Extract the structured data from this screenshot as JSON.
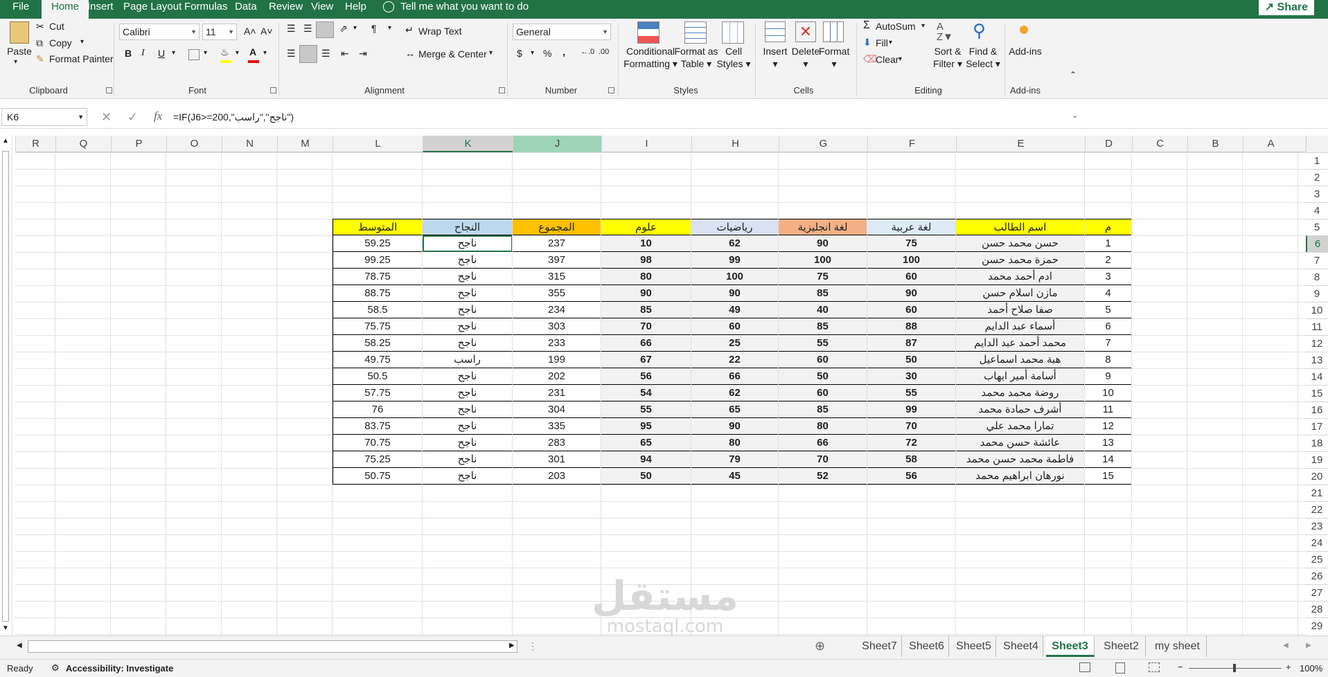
{
  "menu": {
    "items": [
      "File",
      "Home",
      "Insert",
      "Page Layout",
      "Formulas",
      "Data",
      "Review",
      "View",
      "Help"
    ],
    "tell_me": "Tell me what you want to do",
    "share": "Share"
  },
  "ribbon": {
    "clipboard": {
      "paste": "Paste",
      "cut": "Cut",
      "copy": "Copy",
      "format_painter": "Format Painter",
      "label": "Clipboard"
    },
    "font": {
      "name": "Calibri",
      "size": "11",
      "label": "Font"
    },
    "alignment": {
      "wrap": "Wrap Text",
      "merge": "Merge & Center",
      "label": "Alignment"
    },
    "number": {
      "format": "General",
      "label": "Number"
    },
    "styles": {
      "cond1": "Conditional",
      "cond2": "Formatting",
      "fmt1": "Format as",
      "fmt2": "Table",
      "cell1": "Cell",
      "cell2": "Styles",
      "label": "Styles"
    },
    "cells": {
      "insert": "Insert",
      "delete": "Delete",
      "format": "Format",
      "label": "Cells"
    },
    "editing": {
      "autosum": "AutoSum",
      "fill": "Fill",
      "clear": "Clear",
      "sort1": "Sort &",
      "sort2": "Filter",
      "find1": "Find &",
      "find2": "Select",
      "label": "Editing"
    },
    "addins": {
      "btn": "Add-ins",
      "label": "Add-ins"
    }
  },
  "formula_bar": {
    "name_box": "K6",
    "formula": "=IF(J6>=200,\"ناجح\",\"راسب\")"
  },
  "columns": [
    "R",
    "Q",
    "P",
    "O",
    "N",
    "M",
    "L",
    "K",
    "J",
    "I",
    "H",
    "G",
    "F",
    "E",
    "D",
    "C",
    "B",
    "A"
  ],
  "rows": [
    "1",
    "2",
    "3",
    "4",
    "5",
    "6",
    "7",
    "8",
    "9",
    "10",
    "11",
    "12",
    "13",
    "14",
    "15",
    "16",
    "17",
    "18",
    "19",
    "20",
    "21",
    "22",
    "23",
    "24",
    "25",
    "26",
    "27",
    "28",
    "29"
  ],
  "table": {
    "headers": {
      "L": "المتوسط",
      "K": "النجاح",
      "J": "المجموع",
      "I": "علوم",
      "H": "رياضيات",
      "G": "لغة انجليزية",
      "F": "لغة عربية",
      "E": "اسم الطالب",
      "D": "م"
    },
    "header_colors": {
      "L": "#ffff00",
      "K": "#bdd7ee",
      "J": "#ffc000",
      "I": "#ffff00",
      "H": "#d9e1f2",
      "G": "#f4b084",
      "F": "#ddebf7",
      "E": "#ffff00",
      "D": "#ffff00"
    },
    "rows": [
      {
        "L": "59.25",
        "K": "ناجح",
        "J": "237",
        "I": "10",
        "H": "62",
        "G": "90",
        "F": "75",
        "E": "حسن محمد حسن",
        "D": "1"
      },
      {
        "L": "99.25",
        "K": "ناجح",
        "J": "397",
        "I": "98",
        "H": "99",
        "G": "100",
        "F": "100",
        "E": "حمزة محمد حسن",
        "D": "2"
      },
      {
        "L": "78.75",
        "K": "ناجح",
        "J": "315",
        "I": "80",
        "H": "100",
        "G": "75",
        "F": "60",
        "E": "ادم أحمد محمد",
        "D": "3"
      },
      {
        "L": "88.75",
        "K": "ناجح",
        "J": "355",
        "I": "90",
        "H": "90",
        "G": "85",
        "F": "90",
        "E": "مازن اسلام حسن",
        "D": "4"
      },
      {
        "L": "58.5",
        "K": "ناجح",
        "J": "234",
        "I": "85",
        "H": "49",
        "G": "40",
        "F": "60",
        "E": "صفا صلاح أحمد",
        "D": "5"
      },
      {
        "L": "75.75",
        "K": "ناجح",
        "J": "303",
        "I": "70",
        "H": "60",
        "G": "85",
        "F": "88",
        "E": "أسماء عبد الدايم",
        "D": "6"
      },
      {
        "L": "58.25",
        "K": "ناجح",
        "J": "233",
        "I": "66",
        "H": "25",
        "G": "55",
        "F": "87",
        "E": "محمد أحمد عبد الدايم",
        "D": "7"
      },
      {
        "L": "49.75",
        "K": "راسب",
        "J": "199",
        "I": "67",
        "H": "22",
        "G": "60",
        "F": "50",
        "E": "هبة محمد اسماعيل",
        "D": "8"
      },
      {
        "L": "50.5",
        "K": "ناجح",
        "J": "202",
        "I": "56",
        "H": "66",
        "G": "50",
        "F": "30",
        "E": "أسامة أمير ايهاب",
        "D": "9"
      },
      {
        "L": "57.75",
        "K": "ناجح",
        "J": "231",
        "I": "54",
        "H": "62",
        "G": "60",
        "F": "55",
        "E": "روضة محمد محمد",
        "D": "10"
      },
      {
        "L": "76",
        "K": "ناجح",
        "J": "304",
        "I": "55",
        "H": "65",
        "G": "85",
        "F": "99",
        "E": "أشرف حمادة محمد",
        "D": "11"
      },
      {
        "L": "83.75",
        "K": "ناجح",
        "J": "335",
        "I": "95",
        "H": "90",
        "G": "80",
        "F": "70",
        "E": "تمارا محمد علي",
        "D": "12"
      },
      {
        "L": "70.75",
        "K": "ناجح",
        "J": "283",
        "I": "65",
        "H": "80",
        "G": "66",
        "F": "72",
        "E": "عائشة حسن محمد",
        "D": "13"
      },
      {
        "L": "75.25",
        "K": "ناجح",
        "J": "301",
        "I": "94",
        "H": "79",
        "G": "70",
        "F": "58",
        "E": "فاطمة محمد حسن محمد",
        "D": "14"
      },
      {
        "L": "50.75",
        "K": "ناجح",
        "J": "203",
        "I": "50",
        "H": "45",
        "G": "52",
        "F": "56",
        "E": "نورهان ابراهيم محمد",
        "D": "15"
      }
    ]
  },
  "sheet_tabs": [
    "Sheet7",
    "Sheet6",
    "Sheet5",
    "Sheet4",
    "Sheet3",
    "Sheet2",
    "my sheet"
  ],
  "active_tab": "Sheet3",
  "status": {
    "ready": "Ready",
    "accessibility": "Accessibility: Investigate",
    "zoom": "100%"
  },
  "watermark": {
    "ar": "مستقل",
    "en": "mostaql.com"
  },
  "colors": {
    "excel_green": "#217346"
  }
}
